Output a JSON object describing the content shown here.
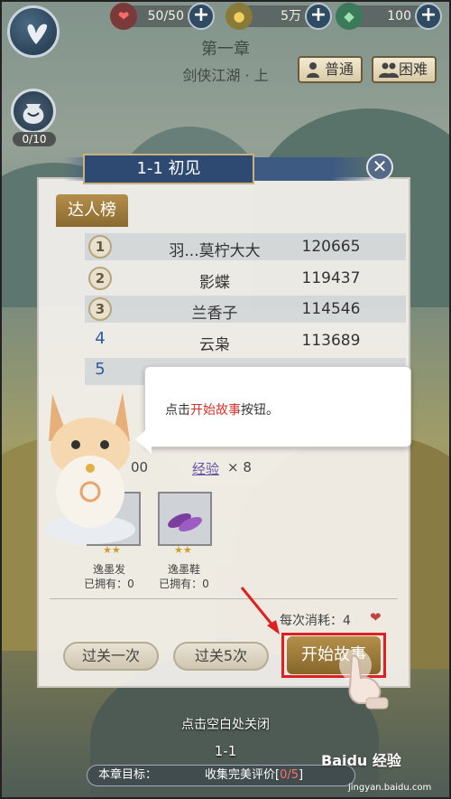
{
  "resources": {
    "stamina": "50/50",
    "coins": "5万",
    "jade": "100"
  },
  "chapter": {
    "title": "第一章",
    "subtitle": "剑侠江湖 · 上"
  },
  "modes": {
    "normal": "普通",
    "hard": "困难"
  },
  "bag_count": "0/10",
  "dialog": {
    "title": "1-1 初见",
    "close_symbol": "✕",
    "tab": "达人榜"
  },
  "ranking": [
    {
      "rank": "1",
      "name": "羽...莫柠大大",
      "score": "120665"
    },
    {
      "rank": "2",
      "name": "影蝶",
      "score": "119437"
    },
    {
      "rank": "3",
      "name": "兰香子",
      "score": "114546"
    },
    {
      "rank": "4",
      "name": "云枭",
      "score": "113689"
    },
    {
      "rank": "5",
      "name": "",
      "score": ""
    }
  ],
  "tooltip": {
    "prefix": "点击",
    "highlight": "开始故事",
    "suffix": "按钮。"
  },
  "rewards": {
    "partial": "00",
    "exp_label": "经验",
    "exp_count": "× 8"
  },
  "items": [
    {
      "name": "逸墨发",
      "owned": "已拥有：0",
      "stars": "★★"
    },
    {
      "name": "逸墨鞋",
      "owned": "已拥有：0",
      "stars": "★★"
    }
  ],
  "cost": {
    "label": "每次消耗：4",
    "icon": "heart-icon"
  },
  "actions": {
    "once": "过关一次",
    "five": "过关5次",
    "start": "开始故事"
  },
  "close_hint": "点击空白处关闭",
  "stage": "1-1",
  "goal": {
    "label": "本章目标：",
    "value_prefix": "收集完美评价[",
    "value_progress": "0/5",
    "value_suffix": "]"
  },
  "watermark": {
    "brand": "Baidu 经验",
    "site": "jingyan.baidu.com"
  },
  "colors": {
    "accent_gold": "#b48f4b",
    "highlight_red": "#d9302a",
    "dialog_title_blue": "#2e4a73"
  }
}
